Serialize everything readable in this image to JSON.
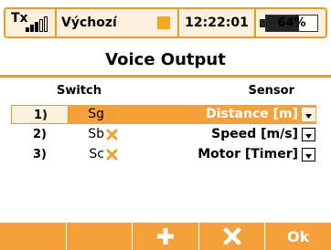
{
  "status_bar": {
    "tx_label": "Tx",
    "signal_level": 3,
    "model_name": "Výchozí",
    "time": "12:22:01",
    "battery_text": "64%",
    "battery_level": 0.64
  },
  "page": {
    "title": "Voice Output"
  },
  "table": {
    "headers": {
      "switch": "Switch",
      "sensor": "Sensor"
    },
    "rows": [
      {
        "num": "1)",
        "switch": "Sg",
        "sensor": "Distance  [m]",
        "selected": true
      },
      {
        "num": "2)",
        "switch": "Sb",
        "sensor": "Speed  [m/s]",
        "selected": false
      },
      {
        "num": "3)",
        "switch": "Sc",
        "sensor": "Motor  [Timer]",
        "selected": false
      }
    ]
  },
  "footer": {
    "buttons": [
      {
        "name": "f1",
        "label": "",
        "icon": ""
      },
      {
        "name": "f2",
        "label": "",
        "icon": ""
      },
      {
        "name": "add",
        "label": "",
        "icon": "plus-icon"
      },
      {
        "name": "delete",
        "label": "",
        "icon": "x-icon"
      },
      {
        "name": "ok",
        "label": "Ok",
        "icon": ""
      }
    ]
  },
  "colors": {
    "accent": "#f5a13b",
    "accent_dark": "#e89a2a",
    "status_bg": "#fdf1de"
  }
}
